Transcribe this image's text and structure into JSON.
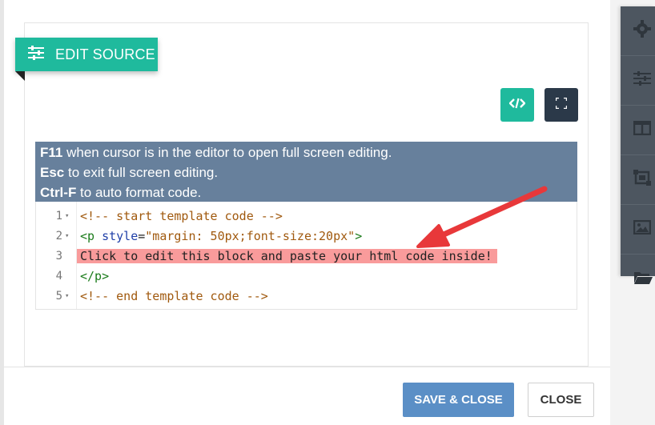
{
  "header": {
    "title": "EDIT SOURCE",
    "icon": "sliders-icon"
  },
  "toolbar": {
    "code_icon": "code-icon",
    "fullscreen_icon": "fullscreen-icon"
  },
  "info": {
    "lines": [
      {
        "key": "F11",
        "text": " when cursor is in the editor to open full screen editing."
      },
      {
        "key": "Esc",
        "text": " to exit full screen editing."
      },
      {
        "key": "Ctrl-F",
        "text": " to auto format code."
      }
    ]
  },
  "editor": {
    "lines": [
      {
        "num": "1",
        "fold": "▾",
        "comment": "<!-- start template code -->"
      },
      {
        "num": "2",
        "fold": "▾",
        "tag_open": "<p ",
        "attr": "style",
        "eq": "=",
        "str": "\"margin: 50px;font-size:20px\"",
        "tag_close": ">"
      },
      {
        "num": "3",
        "text": "Click to edit this block and paste your html code inside!"
      },
      {
        "num": "4",
        "tag": "</p>"
      },
      {
        "num": "5",
        "fold": "▾",
        "comment": "<!-- end template code -->"
      }
    ]
  },
  "sidebar": {
    "items": [
      "gear-icon",
      "sliders-icon",
      "columns-icon",
      "crop-icon",
      "image-icon",
      "folder-icon"
    ]
  },
  "footer": {
    "save_label": "SAVE & CLOSE",
    "close_label": "CLOSE"
  },
  "colors": {
    "accent": "#1fba9d",
    "dark": "#2b3949",
    "info_bg": "#67809c",
    "highlight": "#f99b9b",
    "arrow": "#e8383a",
    "save": "#5b8fc6"
  }
}
